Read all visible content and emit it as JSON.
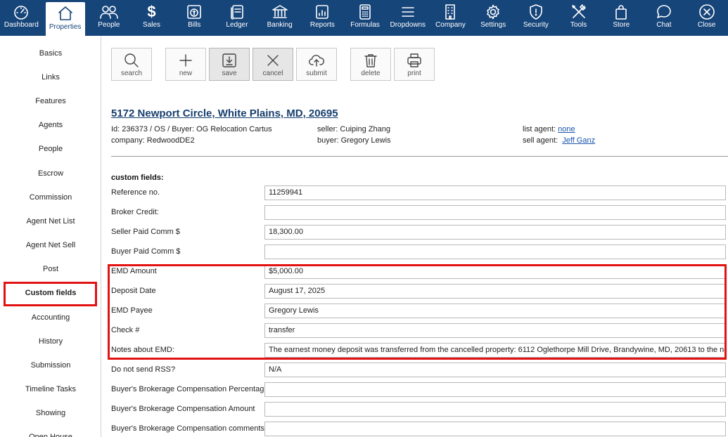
{
  "nav": [
    {
      "id": "dashboard",
      "label": "Dashboard",
      "icon": "dashboard-icon"
    },
    {
      "id": "properties",
      "label": "Properties",
      "icon": "house-icon",
      "active": true
    },
    {
      "id": "people",
      "label": "People",
      "icon": "people-icon"
    },
    {
      "id": "sales",
      "label": "Sales",
      "icon": "dollar-icon"
    },
    {
      "id": "bills",
      "label": "Bills",
      "icon": "bill-icon"
    },
    {
      "id": "ledger",
      "label": "Ledger",
      "icon": "ledger-icon"
    },
    {
      "id": "banking",
      "label": "Banking",
      "icon": "bank-icon"
    },
    {
      "id": "reports",
      "label": "Reports",
      "icon": "reports-icon"
    },
    {
      "id": "formulas",
      "label": "Formulas",
      "icon": "calculator-icon"
    },
    {
      "id": "dropdowns",
      "label": "Dropdowns",
      "icon": "menu-lines-icon"
    },
    {
      "id": "company",
      "label": "Company",
      "icon": "building-icon"
    },
    {
      "id": "settings",
      "label": "Settings",
      "icon": "gear-icon"
    },
    {
      "id": "security",
      "label": "Security",
      "icon": "shield-icon"
    },
    {
      "id": "tools",
      "label": "Tools",
      "icon": "tools-icon"
    },
    {
      "id": "store",
      "label": "Store",
      "icon": "shopping-bag-icon"
    },
    {
      "id": "chat",
      "label": "Chat",
      "icon": "chat-bubble-icon"
    },
    {
      "id": "close",
      "label": "Close",
      "icon": "close-circle-icon"
    }
  ],
  "sidebar": {
    "items": [
      "Basics",
      "Links",
      "Features",
      "Agents",
      "People",
      "Escrow",
      "Commission",
      "Agent Net List",
      "Agent Net Sell",
      "Post",
      "Custom fields",
      "Accounting",
      "History",
      "Submission",
      "Timeline Tasks",
      "Showing",
      "Open House"
    ],
    "selected": "Custom fields"
  },
  "toolbar": {
    "search": "search",
    "new": "new",
    "save": "save",
    "cancel": "cancel",
    "submit": "submit",
    "delete": "delete",
    "print": "print"
  },
  "property": {
    "title": "5172 Newport Circle, White Plains, MD, 20695",
    "id_line": "Id: 236373 / OS / Buyer: OG Relocation Cartus",
    "company_line": "company: RedwoodDE2",
    "seller_line": "seller: Cuiping Zhang",
    "buyer_line": "buyer: Gregory Lewis",
    "list_agent_label": "list agent:",
    "list_agent_value": "none",
    "sell_agent_label": "sell agent:",
    "sell_agent_value": "Jeff Ganz"
  },
  "custom": {
    "title": "custom fields:",
    "fields": [
      {
        "label": "Reference no.",
        "value": "11259941"
      },
      {
        "label": "Broker Credit:",
        "value": ""
      },
      {
        "label": "Seller Paid Comm $",
        "value": " 18,300.00"
      },
      {
        "label": "Buyer Paid Comm $",
        "value": ""
      },
      {
        "label": "EMD Amount",
        "value": "$5,000.00"
      },
      {
        "label": "Deposit Date",
        "value": "August 17, 2025"
      },
      {
        "label": "EMD Payee",
        "value": "Gregory Lewis"
      },
      {
        "label": "Check #",
        "value": "transfer"
      },
      {
        "label": "Notes about EMD:",
        "value": "The earnest money deposit was transferred from the cancelled property: 6112 Oglethorpe Mill Drive, Brandywine, MD, 20613 to the new"
      },
      {
        "label": "Do not send RSS?",
        "value": "N/A"
      },
      {
        "label": "Buyer's Brokerage Compensation Percentage",
        "value": ""
      },
      {
        "label": "Buyer's Brokerage Compensation Amount",
        "value": ""
      },
      {
        "label": "Buyer's Brokerage Compensation comments",
        "value": ""
      }
    ]
  },
  "colors": {
    "nav_bg": "#16457a",
    "highlight": "#e21212",
    "link": "#1a55b0",
    "title": "#163e6e"
  }
}
